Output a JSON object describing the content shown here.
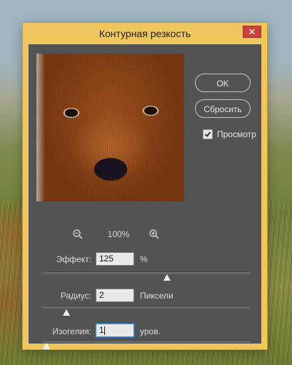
{
  "dialog": {
    "title": "Контурная резкость",
    "close_glyph": "✕"
  },
  "preview": {
    "zoom_level": "100%",
    "zoom_out_icon": "zoom-out-icon",
    "zoom_in_icon": "zoom-in-icon"
  },
  "buttons": {
    "ok_label": "OK",
    "reset_label": "Сбросить"
  },
  "preview_toggle": {
    "label": "Просмотр",
    "checked": true
  },
  "params": {
    "amount": {
      "label": "Эффект:",
      "value": "125",
      "unit": "%",
      "slider_fraction": 0.6
    },
    "radius": {
      "label": "Радиус:",
      "value": "2",
      "unit": "Пиксели",
      "slider_fraction": 0.1
    },
    "threshold": {
      "label": "Изогелия:",
      "value": "1",
      "unit": "уров.",
      "slider_fraction": 0.0
    }
  },
  "colors": {
    "title_bar": "#f0c75f",
    "panel": "#535353",
    "close_button": "#c9443a",
    "active_focus": "#3d8cd6"
  }
}
